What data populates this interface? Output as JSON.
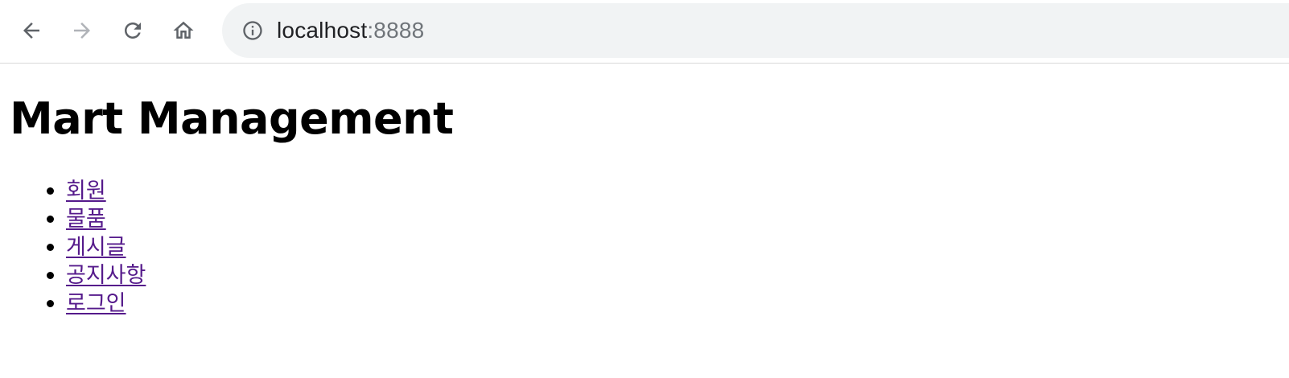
{
  "browser": {
    "url_host": "localhost",
    "url_port": ":8888",
    "icons": {
      "back": "arrow-left-icon",
      "forward": "arrow-right-icon",
      "reload": "reload-icon",
      "home": "home-icon",
      "site_info": "info-icon"
    },
    "colors": {
      "omnibox_bg": "#f1f3f4",
      "icon_active": "#5f6368",
      "icon_disabled": "#b0b3b8"
    }
  },
  "page": {
    "title": "Mart Management",
    "nav_items": [
      {
        "label": "회원"
      },
      {
        "label": "물품"
      },
      {
        "label": "게시글"
      },
      {
        "label": "공지사항"
      },
      {
        "label": "로그인"
      }
    ],
    "colors": {
      "link_visited": "#551a8b",
      "text": "#000000"
    }
  }
}
